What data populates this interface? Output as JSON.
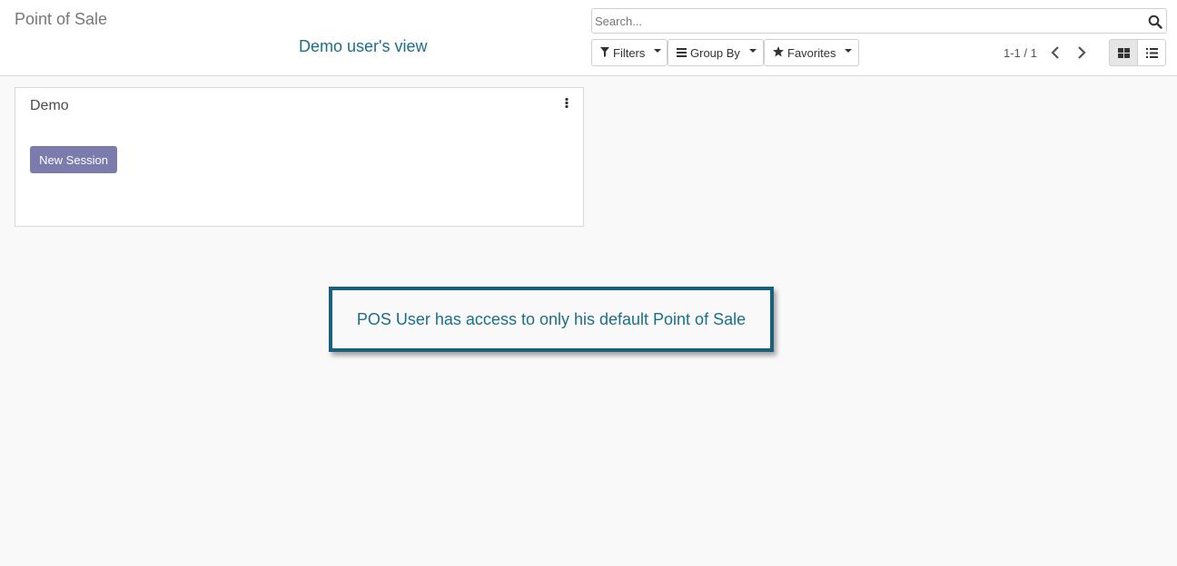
{
  "header": {
    "title": "Point of Sale",
    "subtitle": "Demo user's view"
  },
  "search": {
    "placeholder": "Search...",
    "value": ""
  },
  "filters": {
    "filters_label": "Filters",
    "group_by_label": "Group By",
    "favorites_label": "Favorites"
  },
  "pager": {
    "text": "1-1 / 1"
  },
  "views": {
    "active": "kanban"
  },
  "card": {
    "title": "Demo",
    "button_label": "New Session"
  },
  "callout": {
    "text": "POS User has access to only his default Point of Sale"
  },
  "colors": {
    "primary": "#7c7bad",
    "accent": "#1a6f8a",
    "callout_border": "#1a6079"
  }
}
